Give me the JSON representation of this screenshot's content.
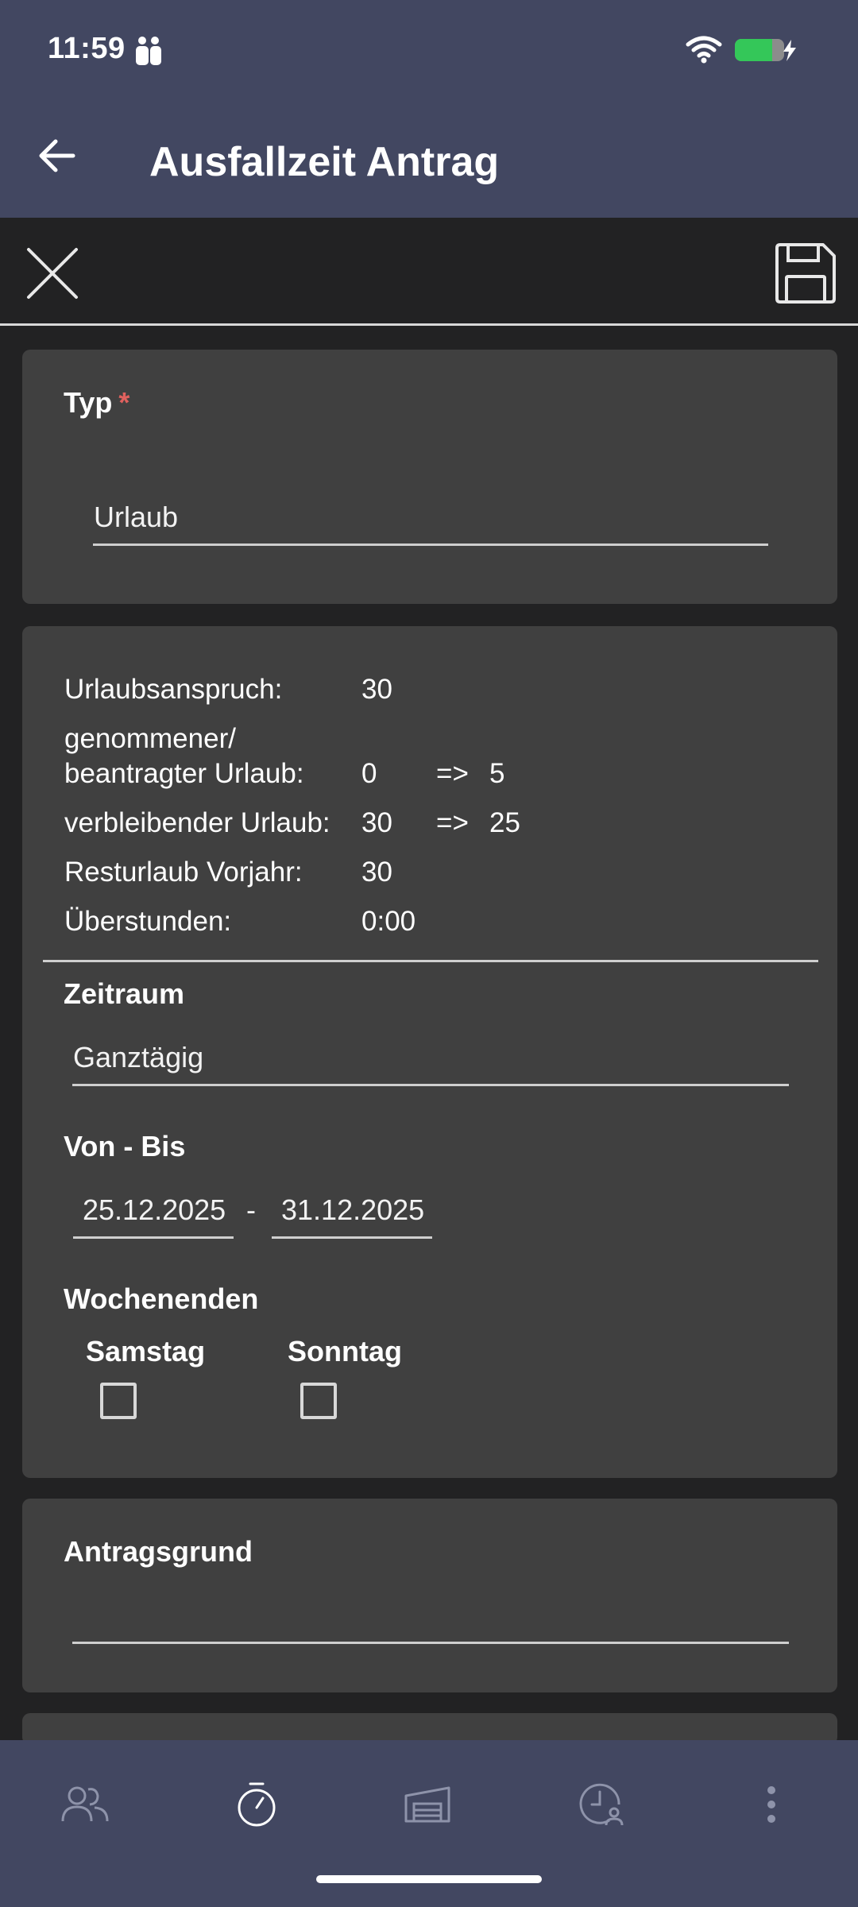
{
  "status": {
    "time": "11:59"
  },
  "header": {
    "title": "Ausfallzeit Antrag"
  },
  "typ": {
    "label": "Typ",
    "required_mark": "*",
    "value": "Urlaub"
  },
  "info": {
    "rows": [
      {
        "label": "Urlaubsanspruch:",
        "value": "30"
      },
      {
        "label_line1": "genommener/",
        "label_line2": "beantragter Urlaub:",
        "value": "0",
        "arrow": "=>",
        "new_value": "5"
      },
      {
        "label": "verbleibender Urlaub:",
        "value": "30",
        "arrow": "=>",
        "new_value": "25"
      },
      {
        "label": "Resturlaub Vorjahr:",
        "value": "30"
      },
      {
        "label": "Überstunden:",
        "value": "0:00"
      }
    ]
  },
  "zeitraum": {
    "label": "Zeitraum",
    "value": "Ganztägig"
  },
  "von_bis": {
    "label": "Von - Bis",
    "from": "25.12.2025",
    "separator": "-",
    "to": "31.12.2025"
  },
  "wochenenden": {
    "label": "Wochenenden",
    "samstag": {
      "label": "Samstag",
      "checked": false
    },
    "sonntag": {
      "label": "Sonntag",
      "checked": false
    }
  },
  "antragsgrund": {
    "label": "Antragsgrund",
    "value": ""
  },
  "nav": {
    "items": [
      {
        "icon": "people-icon"
      },
      {
        "icon": "stopwatch-icon"
      },
      {
        "icon": "building-icon"
      },
      {
        "icon": "clock-person-icon"
      },
      {
        "icon": "more-vertical-icon"
      }
    ]
  },
  "colors": {
    "header_bg": "#424761",
    "page_bg": "#222223",
    "card_bg": "#404040",
    "required": "#e0615e",
    "battery": "#34c759"
  }
}
